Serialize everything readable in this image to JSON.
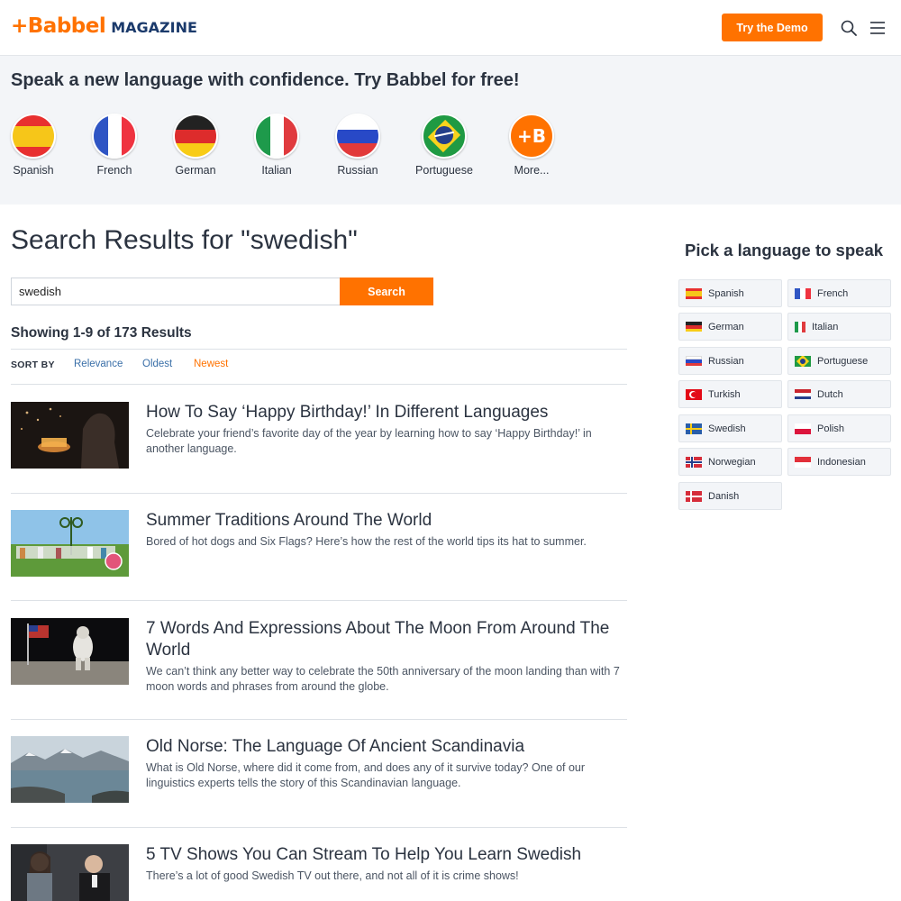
{
  "header": {
    "logo_brand": "+Babbel",
    "logo_section": "MAGAZINE",
    "demo_button": "Try the Demo",
    "icons": [
      "search-icon",
      "menu-icon"
    ]
  },
  "promo": {
    "title": "Speak a new language with confidence. Try Babbel for free!",
    "languages": [
      {
        "label": "Spanish",
        "flag": "spain-flag-icon"
      },
      {
        "label": "French",
        "flag": "france-flag-icon"
      },
      {
        "label": "German",
        "flag": "germany-flag-icon"
      },
      {
        "label": "Italian",
        "flag": "italy-flag-icon"
      },
      {
        "label": "Russian",
        "flag": "russia-flag-icon"
      },
      {
        "label": "Portuguese",
        "flag": "brazil-flag-icon"
      },
      {
        "label": "More...",
        "flag": "babbel-plus-icon"
      }
    ]
  },
  "search": {
    "page_title": "Search Results for \"swedish\"",
    "query": "swedish",
    "button": "Search",
    "results_count": "Showing 1-9 of 173 Results",
    "sort_label": "SORT BY",
    "sort_options": [
      "Relevance",
      "Oldest",
      "Newest"
    ],
    "sort_active": "Newest"
  },
  "articles": [
    {
      "title": "How To Say ‘Happy Birthday!’ In Different Languages",
      "desc": "Celebrate your friend’s favorite day of the year by learning how to say ‘Happy Birthday!’ in another language."
    },
    {
      "title": "Summer Traditions Around The World",
      "desc": "Bored of hot dogs and Six Flags? Here’s how the rest of the world tips its hat to summer."
    },
    {
      "title": "7 Words And Expressions About The Moon From Around The World",
      "desc": "We can’t think any better way to celebrate the 50th anniversary of the moon landing than with 7 moon words and phrases from around the globe."
    },
    {
      "title": "Old Norse: The Language Of Ancient Scandinavia",
      "desc": "What is Old Norse, where did it come from, and does any of it survive today? One of our linguistics experts tells the story of this Scandinavian language."
    },
    {
      "title": "5 TV Shows You Can Stream To Help You Learn Swedish",
      "desc": "There’s a lot of good Swedish TV out there, and not all of it is crime shows!"
    }
  ],
  "sidebar": {
    "title": "Pick a language to speak",
    "languages": [
      "Spanish",
      "French",
      "German",
      "Italian",
      "Russian",
      "Portuguese",
      "Turkish",
      "Dutch",
      "Swedish",
      "Polish",
      "Norwegian",
      "Indonesian",
      "Danish"
    ]
  },
  "colors": {
    "accent": "#ff7200",
    "navy": "#1b3a6b",
    "link": "#3a6fa8",
    "band": "#f3f5f8"
  }
}
